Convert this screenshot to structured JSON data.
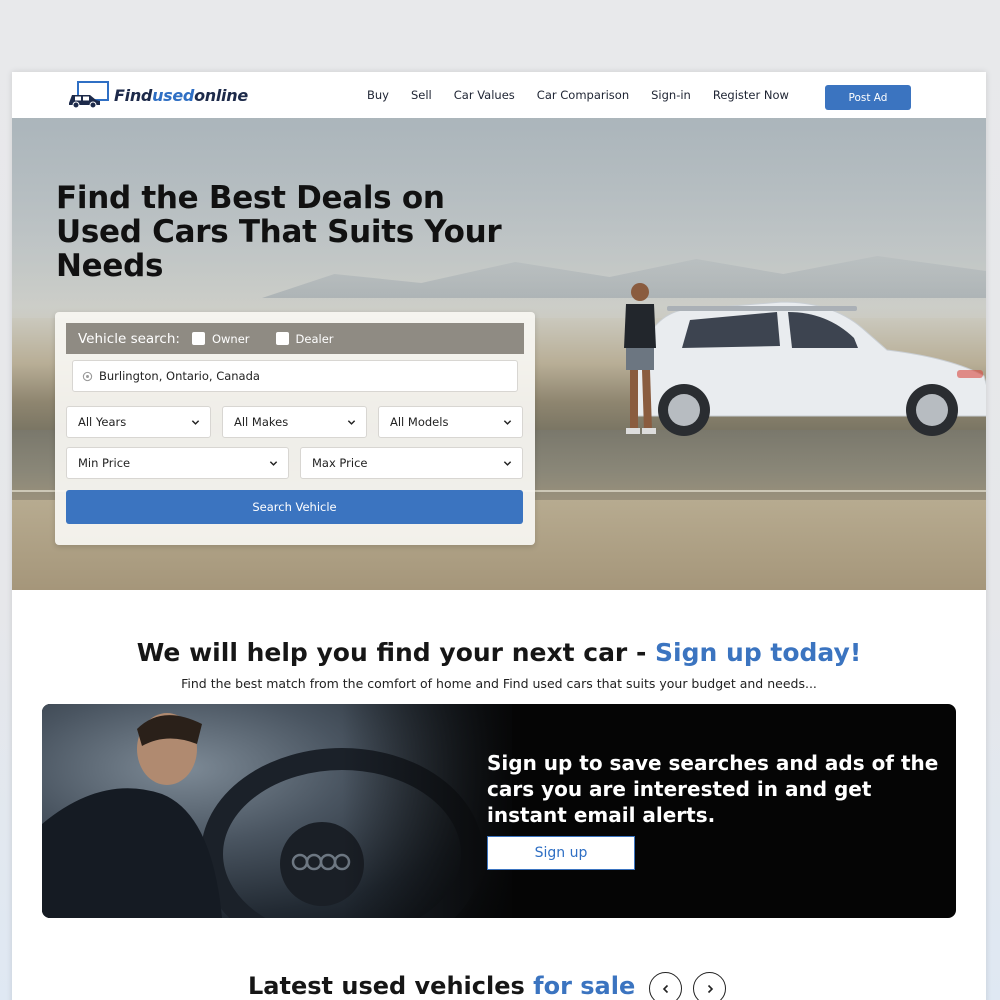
{
  "brand": {
    "name_prefix": "Find",
    "name_mid": "used",
    "name_suffix": "online"
  },
  "nav": {
    "links": [
      "Buy",
      "Sell",
      "Car Values",
      "Car Comparison",
      "Sign-in",
      "Register Now"
    ],
    "post_ad": "Post Ad"
  },
  "hero": {
    "title": "Find the Best Deals on Used Cars That Suits Your Needs"
  },
  "search": {
    "label": "Vehicle search:",
    "owner": "Owner",
    "dealer": "Dealer",
    "location": "Burlington, Ontario, Canada",
    "years": "All Years",
    "makes": "All Makes",
    "models": "All Models",
    "min_price": "Min Price",
    "max_price": "Max Price",
    "button": "Search Vehicle"
  },
  "help": {
    "title_main": "We will help you find your next car - ",
    "title_highlight": "Sign up today!",
    "subtitle": "Find the best match from the comfort of home and Find used cars that suits your budget and needs..."
  },
  "banner": {
    "text": "Sign up to save searches and ads of the cars you are interested in and get instant email alerts.",
    "button": "Sign up"
  },
  "latest": {
    "title_main": "Latest used vehicles ",
    "title_highlight": "for sale"
  },
  "colors": {
    "accent": "#3b74c0",
    "text_dark": "#161616"
  }
}
